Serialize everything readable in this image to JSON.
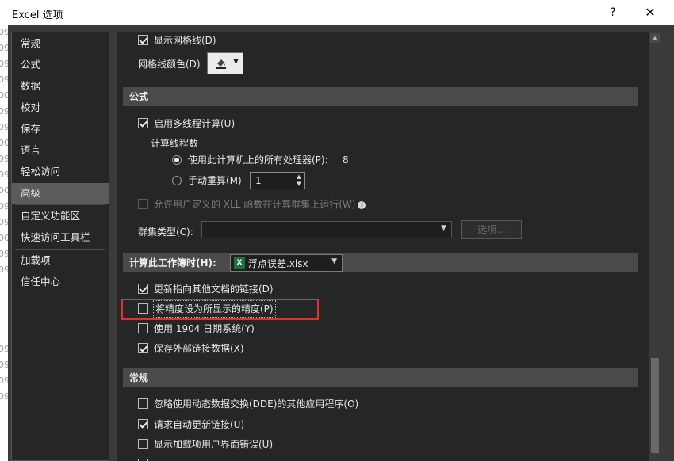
{
  "window": {
    "title": "Excel 选项",
    "help_label": "?",
    "close_label": "✕"
  },
  "left_strip": [
    "09",
    "09",
    "09",
    "09",
    "00",
    "09",
    "09",
    "00",
    "09",
    "09",
    "00",
    "09",
    "09",
    "00",
    "09",
    "09",
    "09",
    "09",
    "09",
    "09"
  ],
  "sidebar": {
    "items": [
      {
        "label": "常规"
      },
      {
        "label": "公式"
      },
      {
        "label": "数据"
      },
      {
        "label": "校对"
      },
      {
        "label": "保存"
      },
      {
        "label": "语言"
      },
      {
        "label": "轻松访问"
      },
      {
        "label": "高级",
        "active": true
      },
      {
        "label": "自定义功能区"
      },
      {
        "label": "快速访问工具栏"
      },
      {
        "label": "加载项"
      },
      {
        "label": "信任中心"
      }
    ]
  },
  "display": {
    "show_gridlines": "显示网格线(D)",
    "show_gridlines_checked": true,
    "gridline_color_label": "网格线颜色(D)"
  },
  "formulas": {
    "header": "公式",
    "multithread": "启用多线程计算(U)",
    "multithread_checked": true,
    "thread_count_label": "计算线程数",
    "use_all_processors": "使用此计算机上的所有处理器(P):",
    "processor_count": "8",
    "manual": "手动重算(M)",
    "manual_value": "1",
    "allow_xll": "允许用户定义的 XLL 函数在计算群集上运行(W)",
    "cluster_type_label": "群集类型(C):",
    "cluster_type_value": "",
    "options_button": "选项..."
  },
  "workbook": {
    "header": "计算此工作簿时(H):",
    "file_name": "浮点误差.xlsx",
    "file_icon": "excel-icon",
    "options": [
      {
        "label": "更新指向其他文档的链接(D)",
        "checked": true
      },
      {
        "label": "将精度设为所显示的精度(P)",
        "checked": false
      },
      {
        "label": "使用 1904 日期系统(Y)",
        "checked": false
      },
      {
        "label": "保存外部链接数据(X)",
        "checked": true
      }
    ]
  },
  "general": {
    "header": "常规",
    "options": [
      {
        "label": "忽略使用动态数据交换(DDE)的其他应用程序(O)",
        "checked": false
      },
      {
        "label": "请求自动更新链接(U)",
        "checked": true
      },
      {
        "label": "显示加载项用户界面错误(U)",
        "checked": false
      }
    ]
  },
  "colors": {
    "background": "#262626",
    "section_header": "#4a4a4a",
    "highlight": "#e03131",
    "excel_green": "#1d6f42"
  }
}
